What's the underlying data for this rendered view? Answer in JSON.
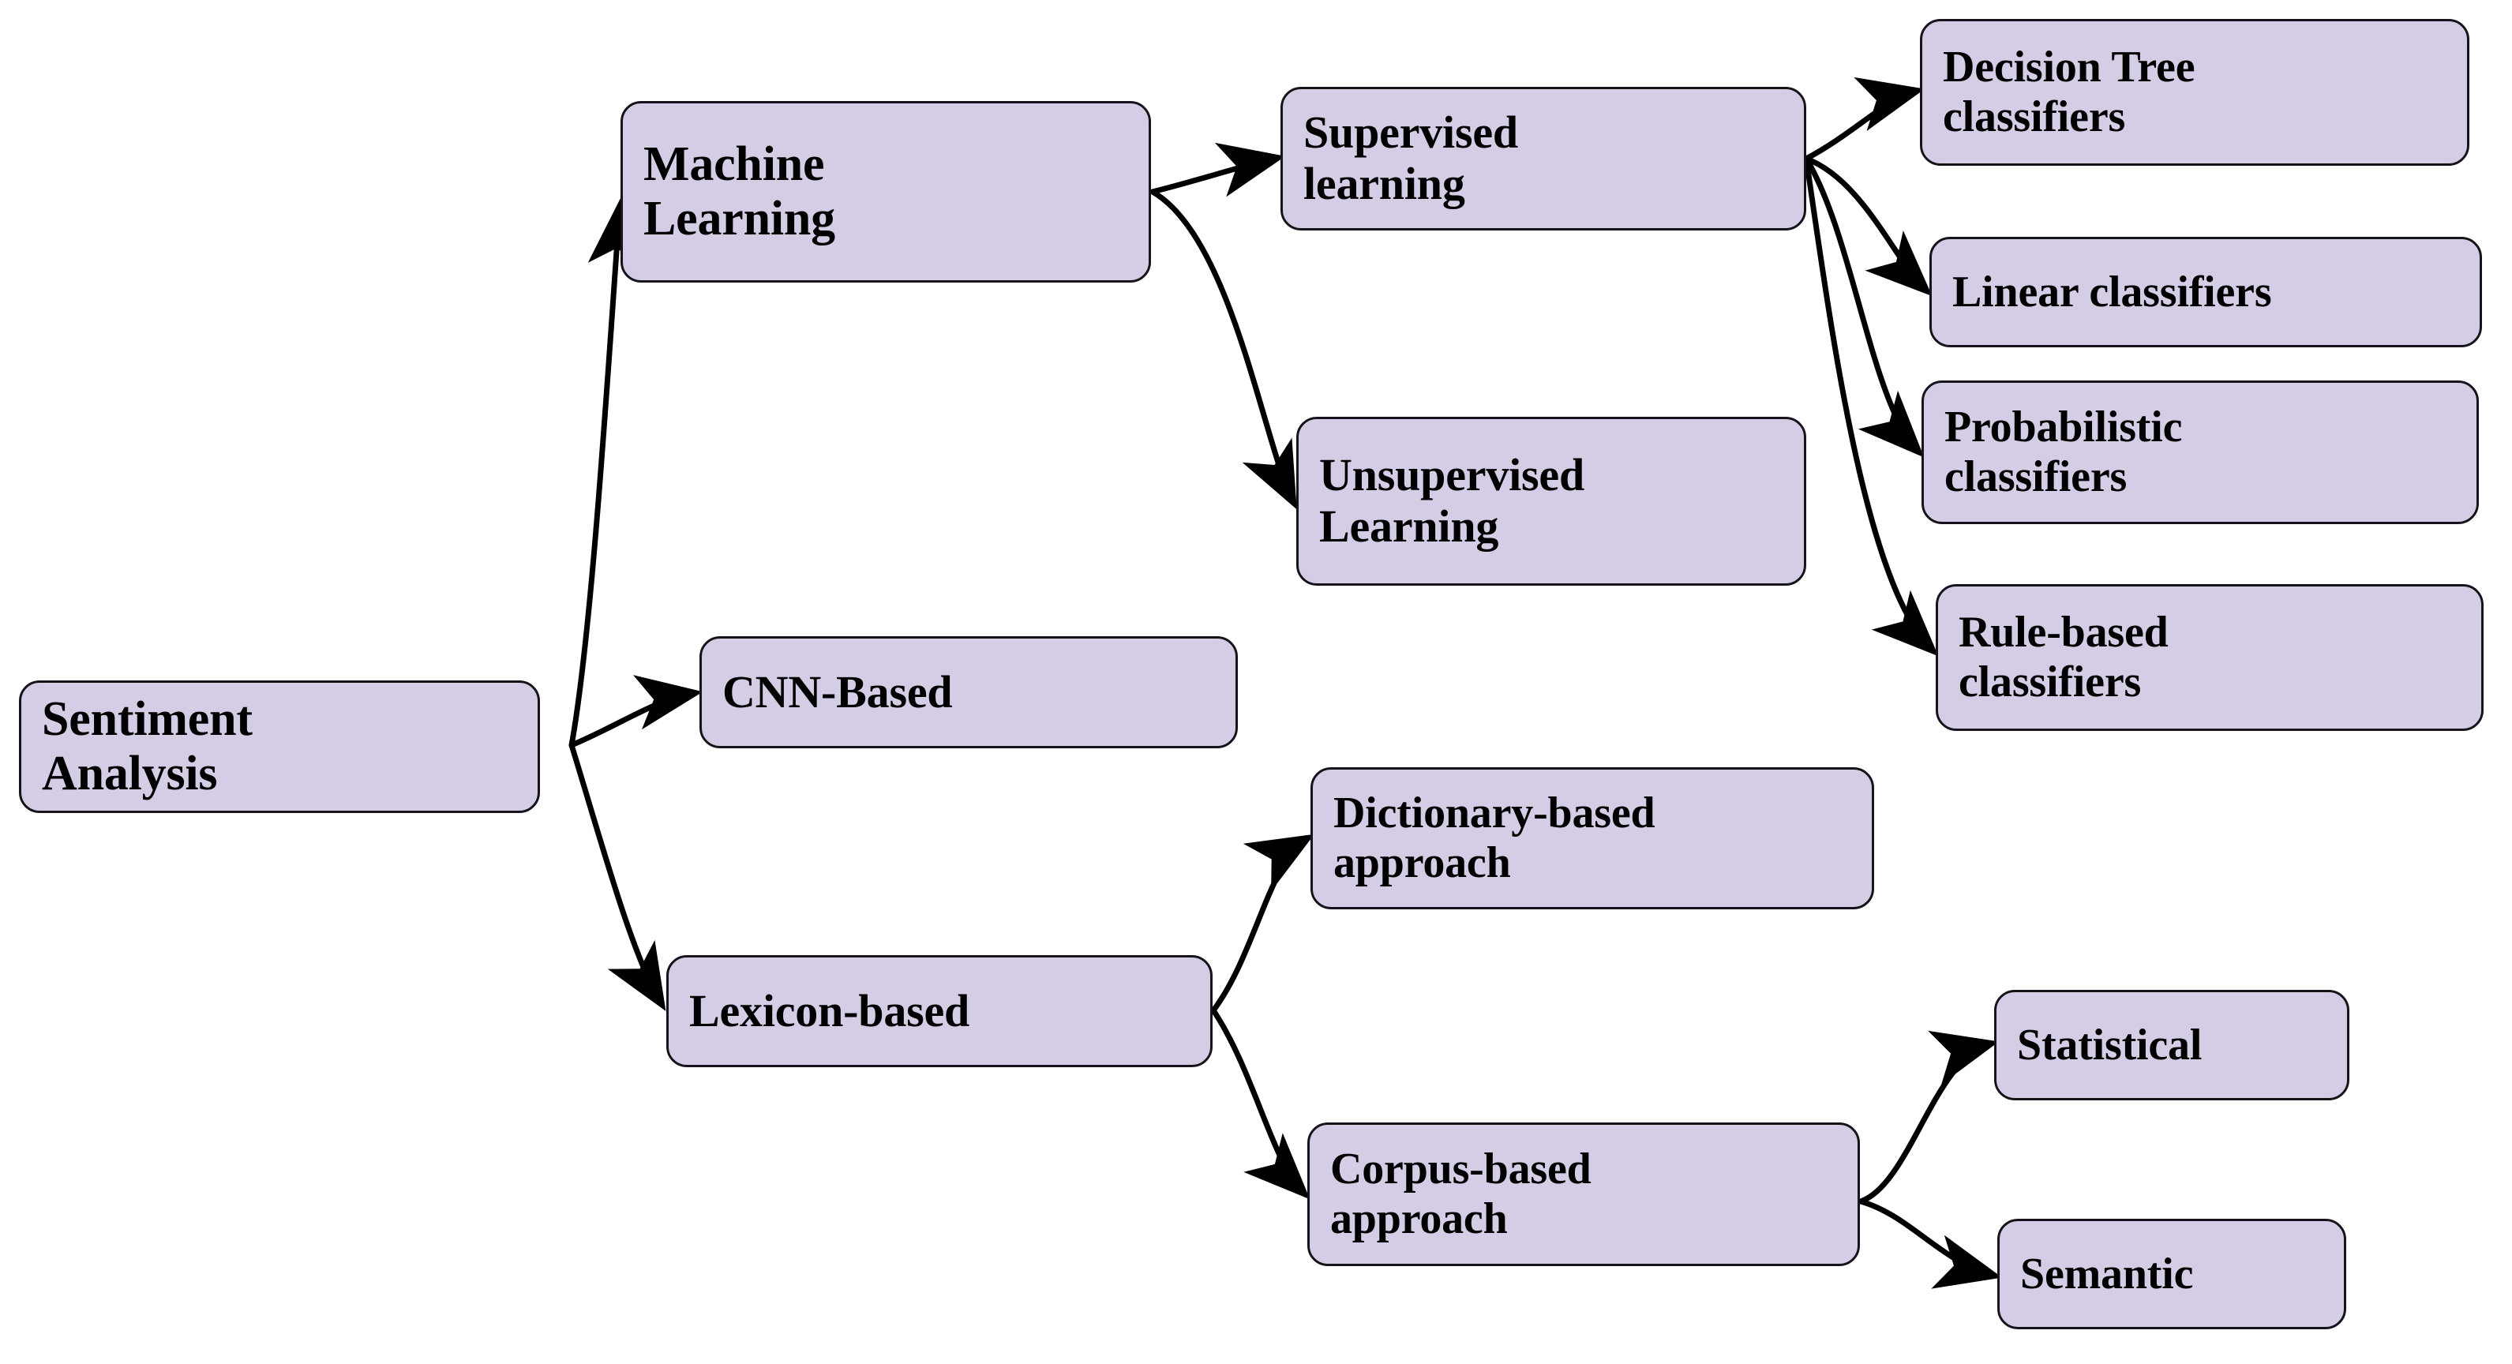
{
  "diagram": {
    "title": "Sentiment Analysis taxonomy",
    "type": "tree-diagram",
    "orientation": "left-to-right",
    "node_fill_color": "#d5cde6",
    "node_border_color": "#16141a",
    "edge_color": "#000000",
    "background_color": "#ffffff",
    "nodes": {
      "root": {
        "label": "Sentiment\nAnalysis"
      },
      "machine_learning": {
        "label": "Machine\nLearning"
      },
      "cnn_based": {
        "label": "CNN-Based"
      },
      "lexicon_based": {
        "label": "Lexicon-based"
      },
      "supervised_learning": {
        "label": "Supervised\nlearning"
      },
      "unsupervised_learning": {
        "label": "Unsupervised\nLearning"
      },
      "decision_tree_classifiers": {
        "label": "Decision Tree\nclassifiers"
      },
      "linear_classifiers": {
        "label": "Linear classifiers"
      },
      "probabilistic_classifiers": {
        "label": "Probabilistic\nclassifiers"
      },
      "rule_based_classifiers": {
        "label": "Rule-based\nclassifiers"
      },
      "dictionary_based_approach": {
        "label": "Dictionary-based\napproach"
      },
      "corpus_based_approach": {
        "label": "Corpus-based\napproach"
      },
      "statistical": {
        "label": "Statistical"
      },
      "semantic": {
        "label": "Semantic"
      }
    },
    "edges": [
      {
        "from": "root",
        "to": "machine_learning"
      },
      {
        "from": "root",
        "to": "cnn_based"
      },
      {
        "from": "root",
        "to": "lexicon_based"
      },
      {
        "from": "machine_learning",
        "to": "supervised_learning"
      },
      {
        "from": "machine_learning",
        "to": "unsupervised_learning"
      },
      {
        "from": "supervised_learning",
        "to": "decision_tree_classifiers"
      },
      {
        "from": "supervised_learning",
        "to": "linear_classifiers"
      },
      {
        "from": "supervised_learning",
        "to": "probabilistic_classifiers"
      },
      {
        "from": "supervised_learning",
        "to": "rule_based_classifiers"
      },
      {
        "from": "lexicon_based",
        "to": "dictionary_based_approach"
      },
      {
        "from": "lexicon_based",
        "to": "corpus_based_approach"
      },
      {
        "from": "corpus_based_approach",
        "to": "statistical"
      },
      {
        "from": "corpus_based_approach",
        "to": "semantic"
      }
    ]
  }
}
